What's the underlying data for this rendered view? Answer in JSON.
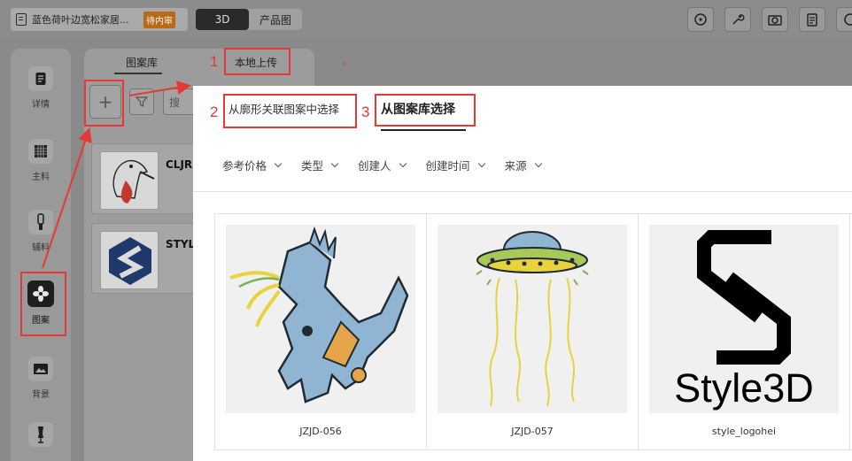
{
  "topbar": {
    "doc_title": "蓝色荷叶边宽松家居...",
    "status_badge": "待内审",
    "views": [
      "3D",
      "产品图"
    ],
    "active_view": "3D"
  },
  "sidebar": {
    "items": [
      {
        "label": "详情",
        "icon": "document-icon"
      },
      {
        "label": "主料",
        "icon": "fabric-grid-icon"
      },
      {
        "label": "辅料",
        "icon": "zipper-icon"
      },
      {
        "label": "图案",
        "icon": "pattern-icon",
        "active": true
      },
      {
        "label": "背景",
        "icon": "image-icon"
      },
      {
        "label": "",
        "icon": "mannequin-icon"
      }
    ]
  },
  "library_panel": {
    "tabs": [
      "图案库",
      "本地上传"
    ],
    "search_placeholder": "搜",
    "cards": [
      {
        "name": "CLJR"
      },
      {
        "name": "STYL"
      }
    ]
  },
  "modal": {
    "tabs": [
      "从廓形关联图案中选择",
      "从图案库选择"
    ],
    "active_tab": "从图案库选择",
    "filters": [
      "参考价格",
      "类型",
      "创建人",
      "创建时间",
      "来源"
    ],
    "items": [
      {
        "name": "JZJD-056"
      },
      {
        "name": "JZJD-057"
      },
      {
        "name": "style_logohei",
        "logo_text": "Style3D"
      }
    ]
  },
  "annotations": {
    "numbers": [
      "1",
      "2",
      "3"
    ],
    "color": "#e53935"
  }
}
